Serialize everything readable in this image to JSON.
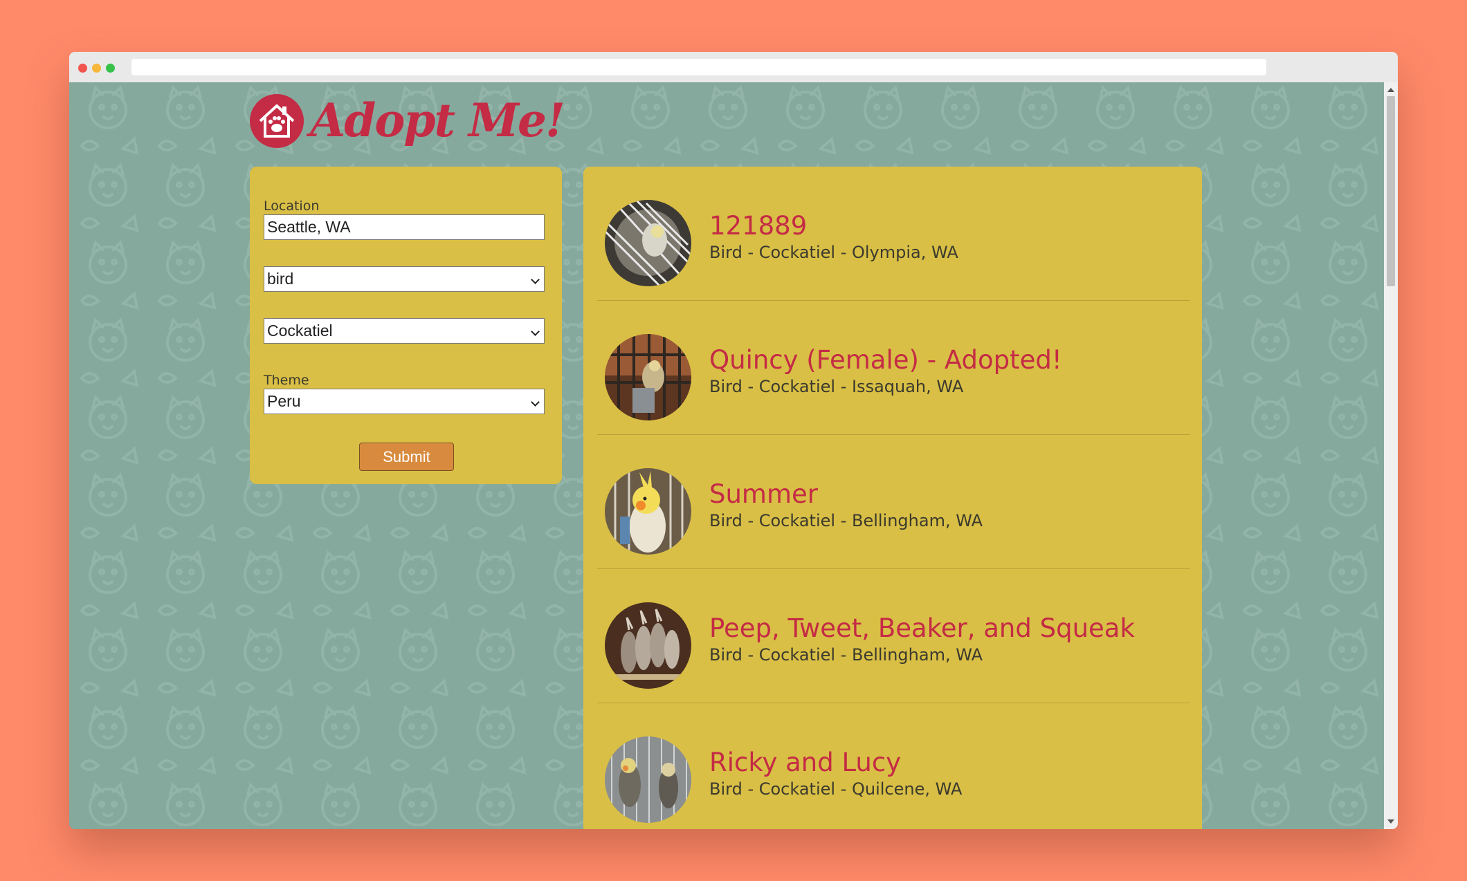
{
  "browser": {
    "url": ""
  },
  "app": {
    "logo_text": "Adopt Me!"
  },
  "search": {
    "location_label": "Location",
    "location_value": "Seattle, WA",
    "animal_value": "bird",
    "breed_value": "Cockatiel",
    "theme_label": "Theme",
    "theme_value": "Peru",
    "submit_label": "Submit"
  },
  "results": [
    {
      "name": "121889",
      "description": "Bird - Cockatiel - Olympia, WA"
    },
    {
      "name": "Quincy (Female) - Adopted!",
      "description": "Bird - Cockatiel - Issaquah, WA"
    },
    {
      "name": "Summer",
      "description": "Bird - Cockatiel - Bellingham, WA"
    },
    {
      "name": "Peep, Tweet, Beaker, and Squeak",
      "description": "Bird - Cockatiel - Bellingham, WA"
    },
    {
      "name": "Ricky and Lucy",
      "description": "Bird - Cockatiel - Quilcene, WA"
    }
  ],
  "colors": {
    "page_background": "#ff8a6a",
    "app_background": "#86a99d",
    "panel": "#d9bf45",
    "brand_red": "#c42b45",
    "submit_button": "#d88b3e"
  }
}
